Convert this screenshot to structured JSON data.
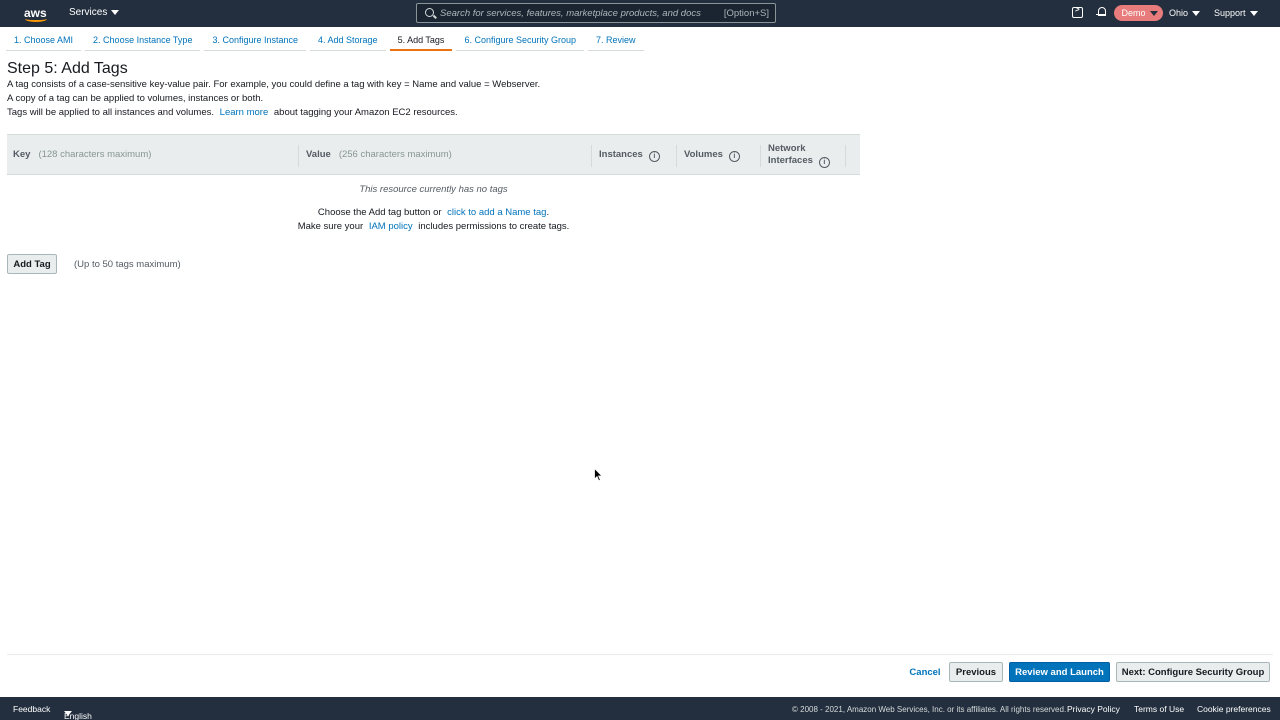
{
  "topnav": {
    "logo_text": "aws",
    "services_label": "Services",
    "search_placeholder": "Search for services, features, marketplace products, and docs",
    "search_shortcut": "[Option+S]",
    "account_label": "Demo",
    "region_label": "Ohio",
    "support_label": "Support"
  },
  "wizard": {
    "tabs": [
      {
        "label": "1. Choose AMI"
      },
      {
        "label": "2. Choose Instance Type"
      },
      {
        "label": "3. Configure Instance"
      },
      {
        "label": "4. Add Storage"
      },
      {
        "label": "5. Add Tags"
      },
      {
        "label": "6. Configure Security Group"
      },
      {
        "label": "7. Review"
      }
    ],
    "active_tab": 4
  },
  "page": {
    "title": "Step 5: Add Tags",
    "desc_line1": "A tag consists of a case-sensitive key-value pair. For example, you could define a tag with key = Name and value = Webserver.",
    "desc_line2": "A copy of a tag can be applied to volumes, instances or both.",
    "desc_line3_pre": "Tags will be applied to all instances and volumes.",
    "desc_line3_link": "Learn more",
    "desc_line3_post": "about tagging your Amazon EC2 resources."
  },
  "table": {
    "key_header": "Key",
    "key_hint": "(128 characters maximum)",
    "value_header": "Value",
    "value_hint": "(256 characters maximum)",
    "instances_header": "Instances",
    "volumes_header": "Volumes",
    "network_header_line1": "Network",
    "network_header_line2": "Interfaces",
    "info_glyph": "i",
    "empty_message": "This resource currently has no tags",
    "choose_pre": "Choose the Add tag button or",
    "choose_link": "click to add a Name tag",
    "choose_post": ".",
    "perm_pre": "Make sure your",
    "perm_link": "IAM policy",
    "perm_post": "includes permissions to create tags."
  },
  "actions": {
    "add_tag_label": "Add Tag",
    "add_tag_hint": "(Up to 50 tags maximum)",
    "cancel_label": "Cancel",
    "previous_label": "Previous",
    "review_launch_label": "Review and Launch",
    "next_label": "Next: Configure Security Group"
  },
  "footer": {
    "feedback": "Feedback",
    "language": "English (US)",
    "copyright": "© 2008 - 2021, Amazon Web Services, Inc. or its affiliates. All rights reserved.",
    "privacy": "Privacy Policy",
    "terms": "Terms of Use",
    "cookies": "Cookie preferences"
  },
  "colors": {
    "nav_bg": "#232f3e",
    "link": "#0073bb",
    "accent": "#ec7211",
    "account_badge": "#e87c7c"
  }
}
